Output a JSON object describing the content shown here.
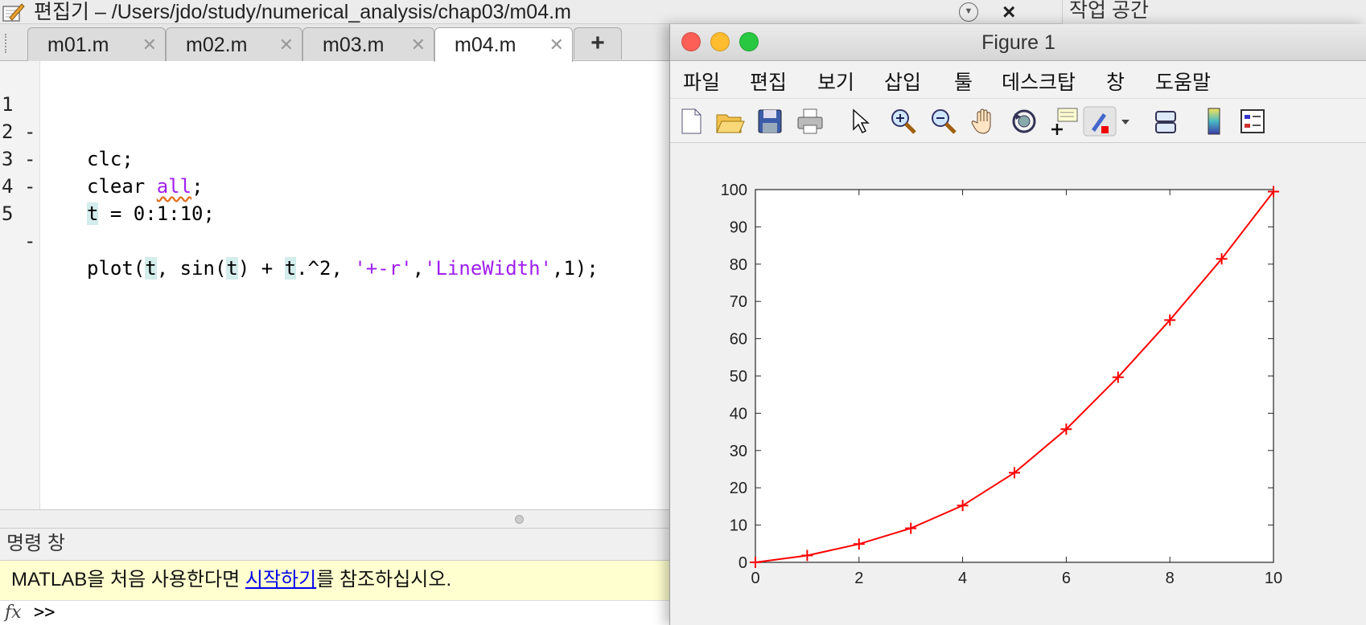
{
  "editor": {
    "title": "편집기 – /Users/jdo/study/numerical_analysis/chap03/m04.m",
    "workspace_label": "작업 공간",
    "tabs": [
      {
        "label": "m01.m"
      },
      {
        "label": "m02.m"
      },
      {
        "label": "m03.m"
      },
      {
        "label": "m04.m",
        "active": true
      }
    ],
    "add_tab_label": "+",
    "code_lines": [
      {
        "num": "1",
        "dash": "-"
      },
      {
        "num": "2",
        "dash": "-"
      },
      {
        "num": "3",
        "dash": "-"
      },
      {
        "num": "4",
        "dash": ""
      },
      {
        "num": "5",
        "dash": "-"
      }
    ],
    "code": {
      "l1": "clc;",
      "l2_a": "clear ",
      "l2_kw": "all",
      "l2_b": ";",
      "l3_t": "t",
      "l3_rest": " = 0:1:10;",
      "l5_a": "plot(",
      "l5_t1": "t",
      "l5_b": ", sin(",
      "l5_t2": "t",
      "l5_c": ") + ",
      "l5_t3": "t",
      "l5_d": ".^2, ",
      "l5_s1": "'+-r'",
      "l5_e": ",",
      "l5_s2": "'LineWidth'",
      "l5_f": ",1);"
    }
  },
  "command_window": {
    "header": "명령 창",
    "notice_before": "MATLAB을 처음 사용한다면 ",
    "notice_link": "시작하기",
    "notice_after": "를 참조하십시오.",
    "fx": "fx",
    "prompt": ">>"
  },
  "figure": {
    "title": "Figure 1",
    "menu": [
      "파일",
      "편집",
      "보기",
      "삽입",
      "툴",
      "데스크탑",
      "창",
      "도움말"
    ],
    "toolbar_icons": [
      "new-file-icon",
      "open-folder-icon",
      "save-icon",
      "print-icon",
      "pointer-icon",
      "zoom-in-icon",
      "zoom-out-icon",
      "pan-hand-icon",
      "rotate-3d-icon",
      "data-cursor-icon",
      "brush-icon",
      "brush-dropdown-icon",
      "link-plot-icon",
      "colorbar-icon",
      "legend-icon"
    ],
    "colors": {
      "line": "#ff0000",
      "close": "#fd5f57",
      "minimize": "#febc2e",
      "zoom": "#28c840"
    }
  },
  "chart_data": {
    "type": "line",
    "title": "",
    "xlabel": "",
    "ylabel": "",
    "x": [
      0,
      1,
      2,
      3,
      4,
      5,
      6,
      7,
      8,
      9,
      10
    ],
    "series": [
      {
        "values": [
          0,
          1.84,
          4.91,
          9.14,
          15.24,
          24.04,
          35.72,
          49.66,
          64.99,
          81.41,
          99.46
        ],
        "color": "#ff0000",
        "marker": "+",
        "line_style": "solid"
      }
    ],
    "xlim": [
      0,
      10
    ],
    "ylim": [
      0,
      100
    ],
    "xticks": [
      "0",
      "2",
      "4",
      "6",
      "8",
      "10"
    ],
    "yticks": [
      "0",
      "10",
      "20",
      "30",
      "40",
      "50",
      "60",
      "70",
      "80",
      "90",
      "100"
    ],
    "grid": false
  }
}
